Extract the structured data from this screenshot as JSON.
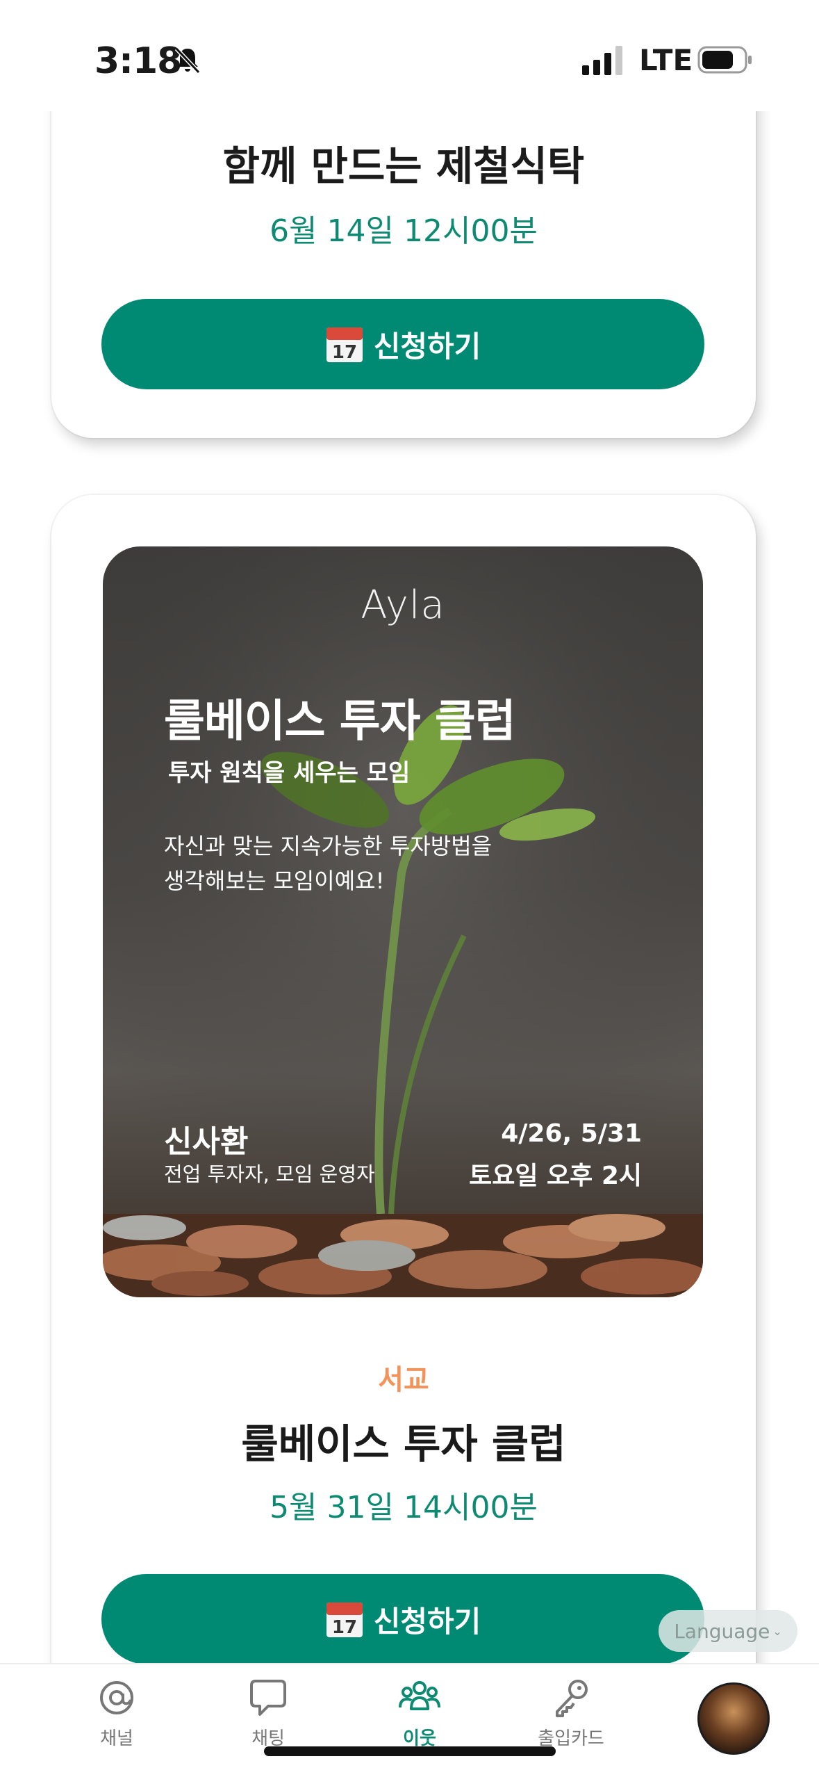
{
  "status_bar": {
    "time": "3:18",
    "network": "LTE"
  },
  "events": [
    {
      "title": "함께 만드는 제철식탁",
      "date": "6월 14일 12시00분",
      "apply_label": "신청하기"
    },
    {
      "poster": {
        "brand": "Ayla",
        "title": "룰베이스 투자 클럽",
        "subtitle": "투자 원칙을 세우는 모임",
        "description_line1": "자신과 맞는 지속가능한 투자방법을",
        "description_line2": "생각해보는 모임이예요!",
        "host_name": "신사환",
        "host_role": "전업 투자자, 모임 운영자",
        "dates": "4/26, 5/31",
        "time": "토요일 오후 2시"
      },
      "location": "서교",
      "title": "룰베이스 투자 클럽",
      "date": "5월 31일 14시00분",
      "apply_label": "신청하기"
    }
  ],
  "language_button": "Language",
  "tab_bar": {
    "items": [
      {
        "label": "채널",
        "icon": "at-icon"
      },
      {
        "label": "채팅",
        "icon": "chat-bubble-icon"
      },
      {
        "label": "이웃",
        "icon": "people-icon",
        "active": true
      },
      {
        "label": "출입카드",
        "icon": "key-icon"
      }
    ],
    "accent_color": "#0e8a72"
  },
  "colors": {
    "primary": "#008a74",
    "date_text": "#0e8a72",
    "location": "#f2935a"
  }
}
